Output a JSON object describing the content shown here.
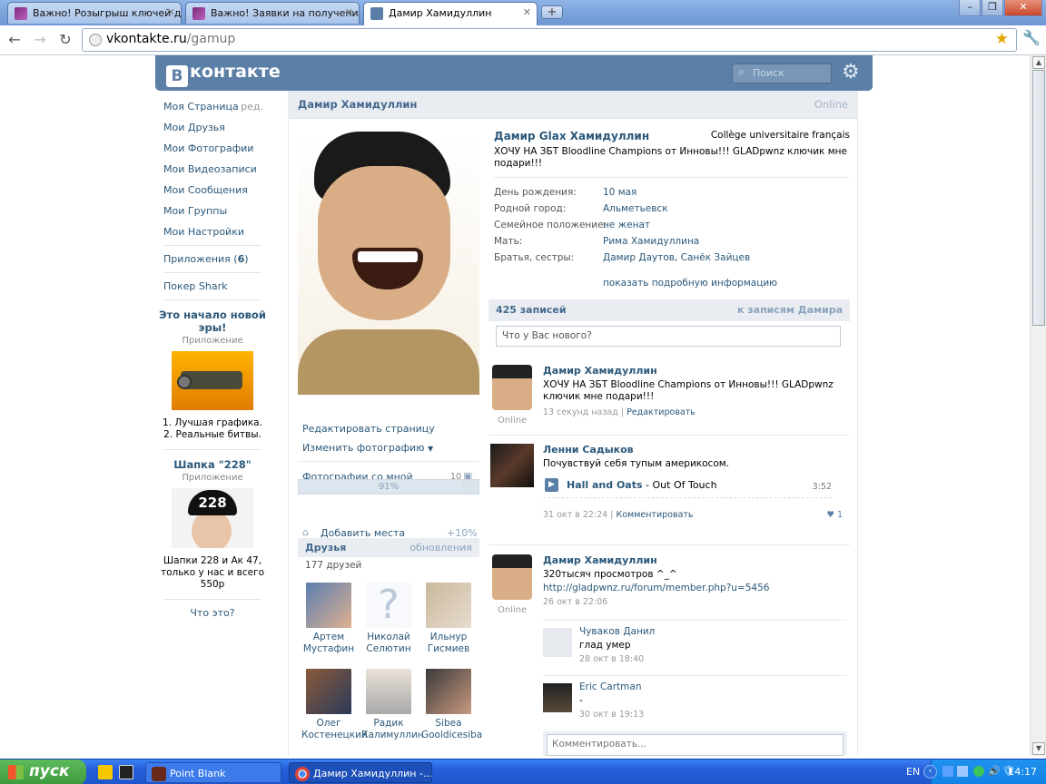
{
  "browser": {
    "tabs": [
      {
        "title": "Важно! Розыгрыш ключей д…",
        "icon": "game-favicon-icon"
      },
      {
        "title": "Важно! Заявки на получение…",
        "icon": "game-favicon-icon"
      },
      {
        "title": "Дамир Хамидуллин",
        "icon": "vk-favicon-icon"
      }
    ],
    "address": {
      "host": "vkontakte.ru",
      "path": "/gamup"
    },
    "controls": {
      "minimize": "–",
      "maximize": "❐",
      "close": "✕",
      "new_tab": "+"
    }
  },
  "vk": {
    "logo": "контакте",
    "logo_b": "В",
    "search_placeholder": "Поиск",
    "menu": [
      {
        "label": "Моя Страница",
        "extra": "ред."
      },
      {
        "label": "Мои Друзья"
      },
      {
        "label": "Мои Фотографии"
      },
      {
        "label": "Мои Видеозаписи"
      },
      {
        "label": "Мои Сообщения"
      },
      {
        "label": "Мои Группы"
      },
      {
        "label": "Мои Настройки"
      }
    ],
    "apps_label": "Приложения (",
    "apps_count": "6",
    "apps_close": ")",
    "poker_label": "Покер Shark",
    "ads": [
      {
        "title": "Это начало новой эры!",
        "subtitle": "Приложение",
        "desc1": "1. Лучшая графика.",
        "desc2": "2. Реальные битвы."
      },
      {
        "title": "Шапка \"228\"",
        "subtitle": "Приложение",
        "desc": "Шапки 228 и Ак 47, только у нас и всего 550р",
        "hat_text": "228"
      }
    ],
    "what_is_it": "Что это?"
  },
  "profile": {
    "header_name": "Дамир Хамидуллин",
    "header_status": "Online",
    "full_name": "Дамир Glax Хамидуллин",
    "school": "Collège universitaire français",
    "status": "ХОЧУ НА ЗБТ Bloodline Champions от Инновы!!! GLADpwnz ключик мне подари!!!",
    "info": [
      {
        "key": "День рождения:",
        "value": "10 мая"
      },
      {
        "key": "Родной город:",
        "value": "Альметьевск"
      },
      {
        "key": "Семейное положение:",
        "value": "не женат"
      },
      {
        "key": "Мать:",
        "value": "Рима Хамидуллина"
      },
      {
        "key": "Братья, сестры:",
        "value": "Дамир Даутов, Санёк Зайцев"
      }
    ],
    "more_info": "показать подробную информацию",
    "edit_page": "Редактировать страницу",
    "change_photo": "Изменить фотографию",
    "photos_with_me": "Фотографии со мной",
    "photos_count": "10",
    "progress_label": "91%",
    "progress_value": 0.91,
    "add_places": "Добавить места",
    "add_places_bonus": "+10%",
    "friends_title": "Друзья",
    "friends_updates": "обновления",
    "friends_count": "177 друзей",
    "friends": [
      {
        "first": "Артем",
        "last": "Мустафин"
      },
      {
        "first": "Николай",
        "last": "Селютин",
        "placeholder": "?"
      },
      {
        "first": "Ильнур",
        "last": "Гисмиев"
      },
      {
        "first": "Олег",
        "last": "Костенецкий"
      },
      {
        "first": "Радик",
        "last": "Калимуллин"
      },
      {
        "first": "Sibea",
        "last": "Gooldicesiba"
      }
    ]
  },
  "wall": {
    "count": "425 записей",
    "to_posts": "к записям Дамира",
    "new_post_placeholder": "Что у Вас нового?",
    "posts": [
      {
        "author": "Дамир Хамидуллин",
        "text": "ХОЧУ НА ЗБТ Bloodline Champions от Инновы!!! GLADpwnz ключик мне подари!!!",
        "time": "13 секунд назад",
        "action": "Редактировать",
        "online": "Online"
      },
      {
        "author": "Ленни Садыков",
        "text": "Почувствуй себя тупым америкосом.",
        "audio_artist": "Hall and Oats",
        "audio_title": " - Out Of Touch",
        "audio_duration": "3:52",
        "time": "31 окт в 22:24",
        "action": "Комментировать",
        "likes": "1"
      },
      {
        "author": "Дамир Хамидуллин",
        "text": "320тысяч просмотров ^_^",
        "link": "http://gladpwnz.ru/forum/member.php?u=5456",
        "time": "26 окт в 22:06",
        "online": "Online"
      }
    ],
    "comments": [
      {
        "author": "Чуваков Данил",
        "text": "глад умер",
        "time": "28 окт в 18:40"
      },
      {
        "author": "Eric Cartman",
        "text": "-",
        "time": "30 окт в 19:13"
      }
    ],
    "comment_placeholder": "Комментировать..."
  },
  "taskbar": {
    "start": "пуск",
    "tasks": [
      {
        "label": "Point Blank"
      },
      {
        "label": "Дамир Хамидуллин -..."
      }
    ],
    "lang": "EN",
    "clock": "14:17"
  }
}
